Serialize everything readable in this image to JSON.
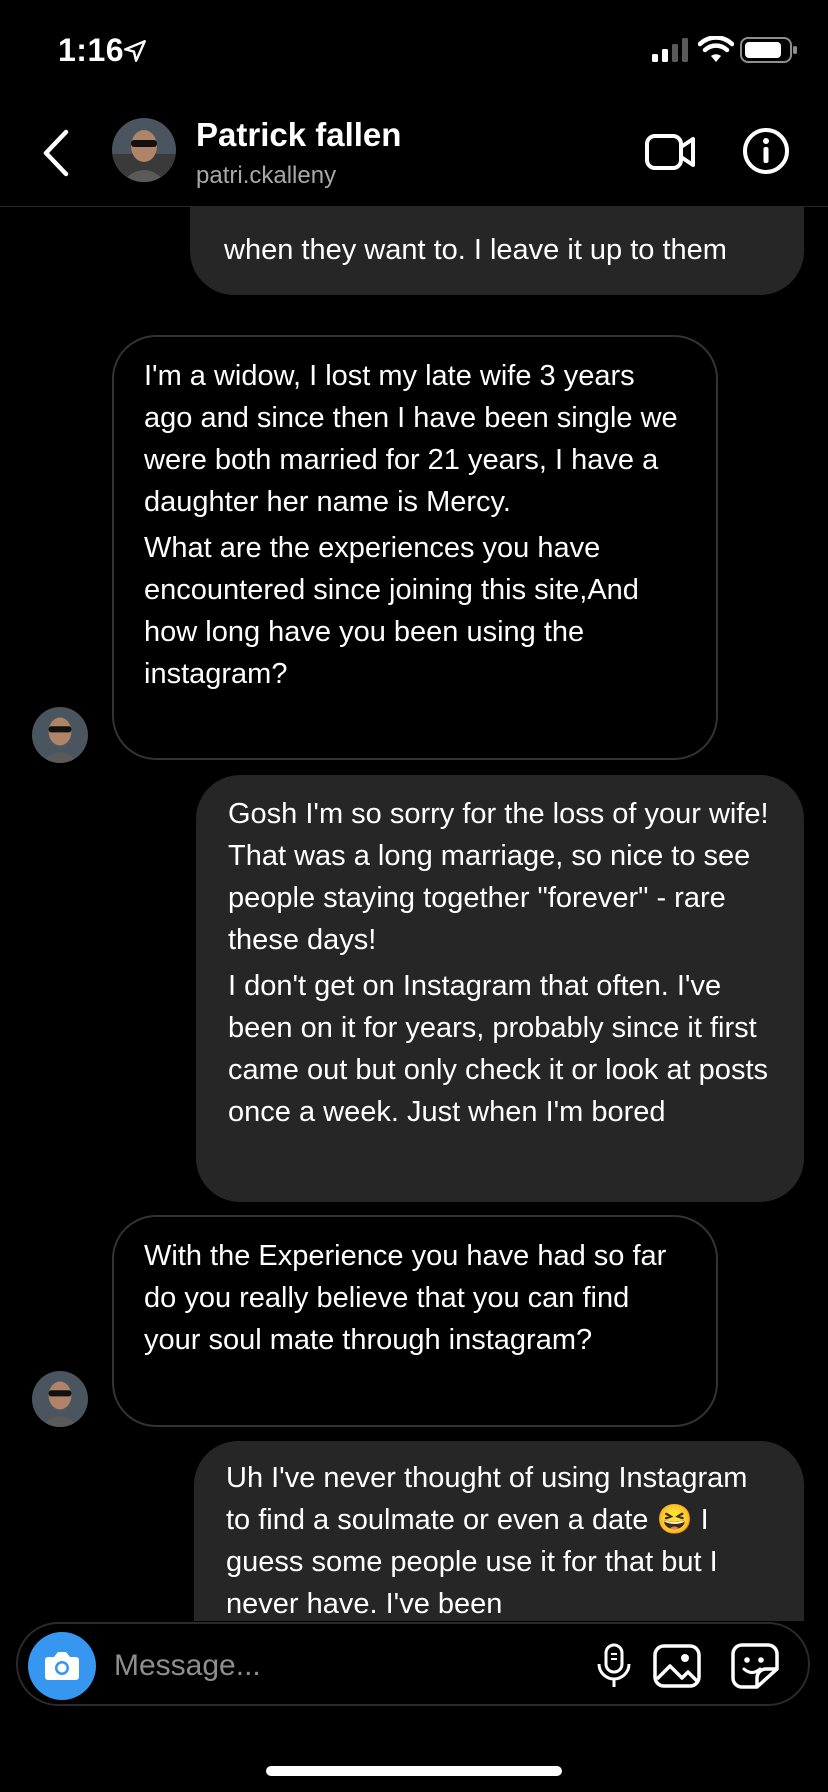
{
  "status_bar": {
    "time": "1:16"
  },
  "header": {
    "name": "Patrick fallen",
    "username": "patri.ckalleny",
    "icons": {
      "back": "chevron-left-icon",
      "video": "video-camera-icon",
      "info": "info-icon"
    }
  },
  "messages": [
    {
      "sender": "me",
      "paragraphs": [
        "when they want to. I leave it up to them"
      ]
    },
    {
      "sender": "them",
      "paragraphs": [
        "I'm a widow, I lost my late wife 3 years ago and since then I have been single we were both married for 21 years, I have a daughter her name is Mercy.",
        "What are the experiences you have encountered since joining this site,And how long have you been using the instagram?"
      ]
    },
    {
      "sender": "me",
      "paragraphs": [
        "Gosh I'm so sorry for the loss of your wife! That was a long marriage, so nice to see people staying together \"forever\" - rare these days!",
        "I don't get on Instagram that often. I've been on it for years, probably since it first came out but only check it or look at posts once a week. Just when I'm bored"
      ]
    },
    {
      "sender": "them",
      "paragraphs": [
        "With the Experience you have had so far do you really believe that you can find your soul mate through instagram?"
      ]
    },
    {
      "sender": "me",
      "paragraphs": [
        "Uh I've never thought of using Instagram to find a soulmate or even a date 😆 I guess some people use it for that but I never have. I've been"
      ]
    }
  ],
  "composer": {
    "placeholder": "Message...",
    "icons": [
      "camera-icon",
      "microphone-icon",
      "gallery-icon",
      "sticker-icon"
    ]
  },
  "colors": {
    "accent": "#3797f0",
    "sent_bubble": "#262626",
    "received_border": "#333333",
    "background": "#000000"
  }
}
